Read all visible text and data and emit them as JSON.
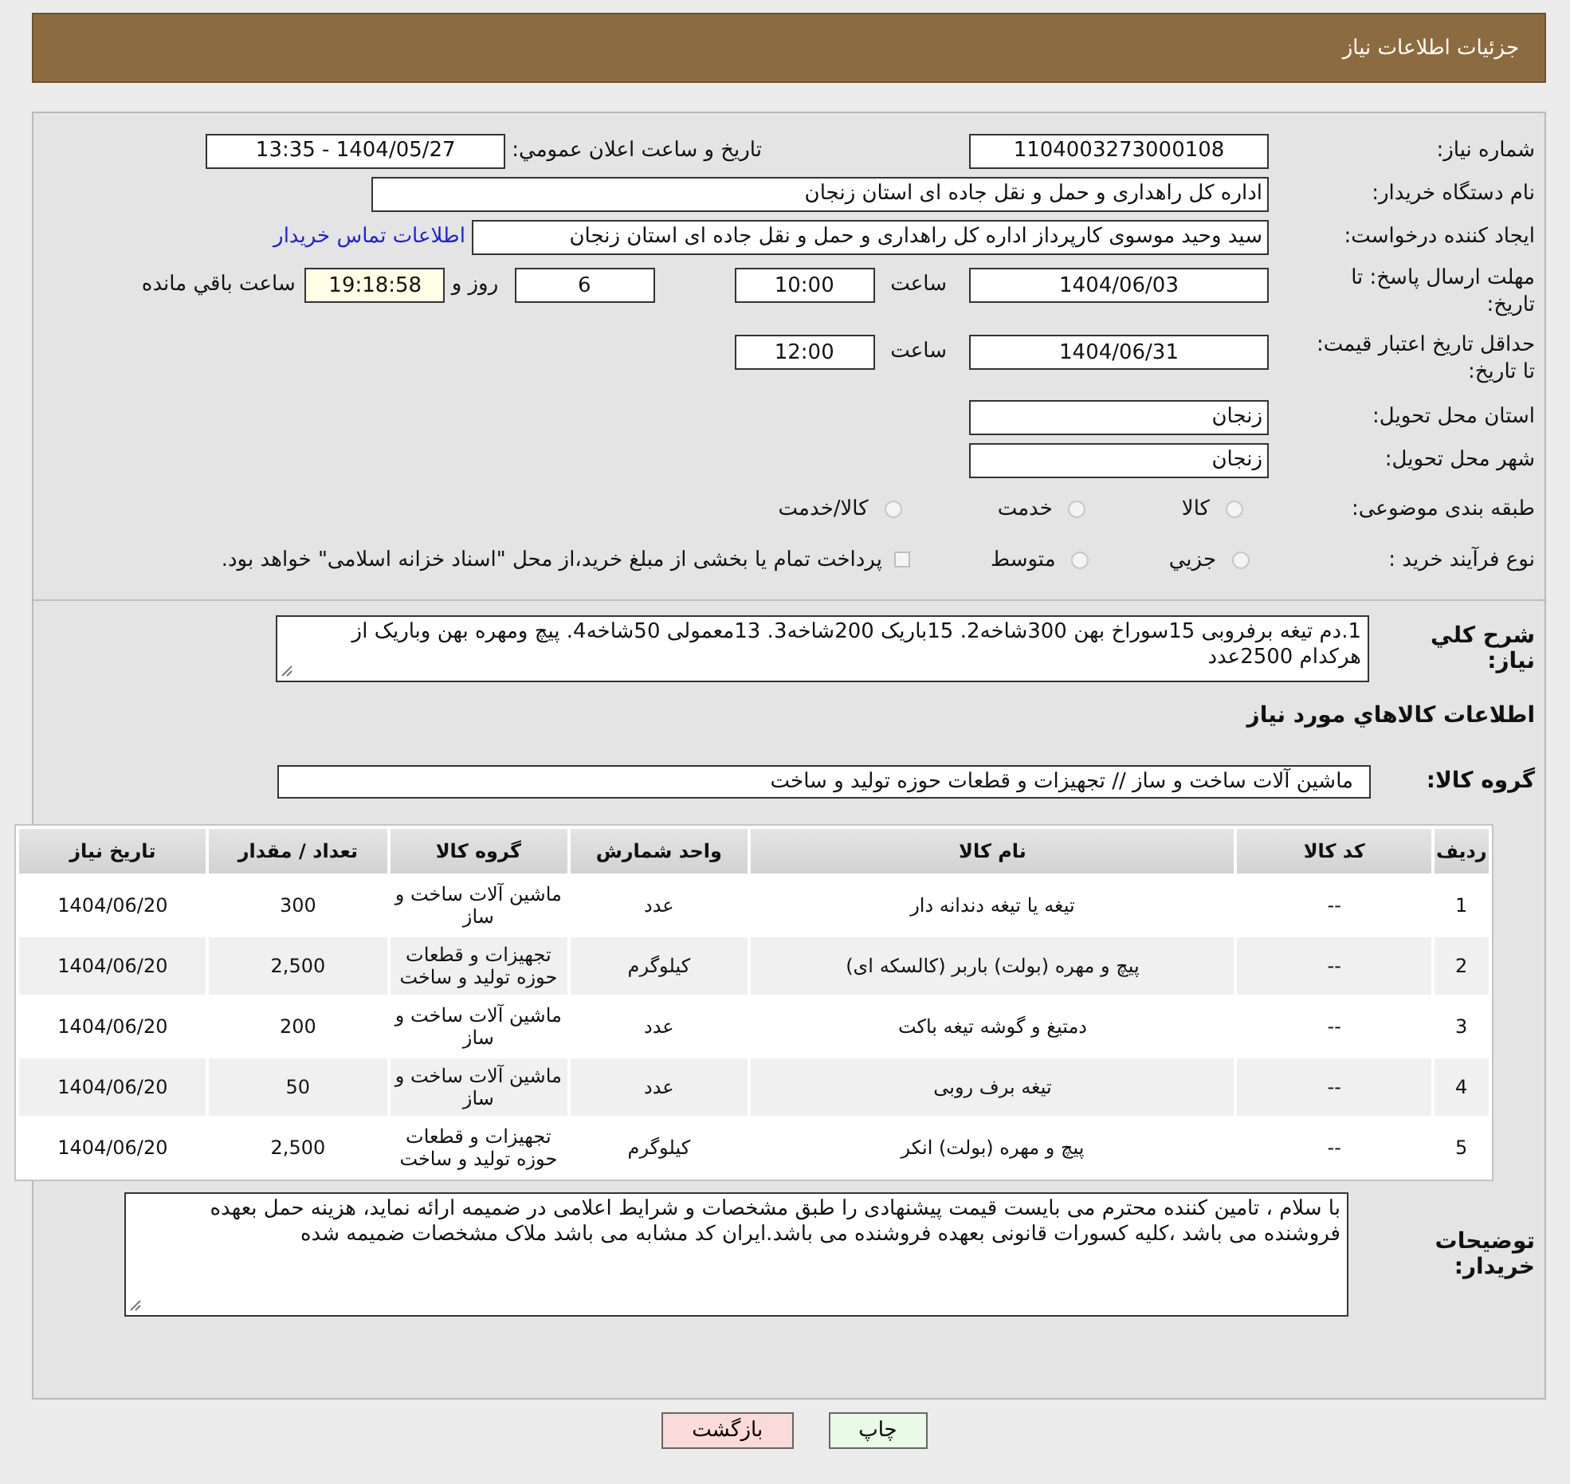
{
  "header": {
    "title": "جزئیات اطلاعات نیاز"
  },
  "need_number": {
    "label": "شماره نیاز:",
    "value": "1104003273000108"
  },
  "announce": {
    "label": "تاریخ و ساعت اعلان عمومي:",
    "value": "1404/05/27 - 13:35"
  },
  "buyer_org": {
    "label": "نام دستگاه خریدار:",
    "value": "اداره کل راهداری و حمل و نقل جاده ای استان زنجان"
  },
  "requester": {
    "label": "ایجاد کننده درخواست:",
    "value": "سید وحید موسوی کارپرداز اداره کل راهداری و حمل و نقل جاده ای استان زنجان",
    "link": "اطلاعات تماس خریدار"
  },
  "response_deadline": {
    "label": "مهلت ارسال پاسخ: تا تاریخ:",
    "date": "1404/06/03",
    "time_label": "ساعت",
    "time": "10:00",
    "days": "6",
    "days_label": "روز و",
    "remaining": "19:18:58",
    "remaining_label": "ساعت باقي مانده"
  },
  "price_validity": {
    "label": "حداقل تاریخ اعتبار قیمت: تا تاریخ:",
    "date": "1404/06/31",
    "time_label": "ساعت",
    "time": "12:00"
  },
  "province": {
    "label": "استان محل تحویل:",
    "value": "زنجان"
  },
  "city": {
    "label": "شهر محل تحویل:",
    "value": "زنجان"
  },
  "category": {
    "label": "طبقه بندی موضوعی:",
    "options": [
      {
        "kind": "radio",
        "label": "کالا",
        "selected": false
      },
      {
        "kind": "radio",
        "label": "خدمت",
        "selected": false
      },
      {
        "kind": "radio",
        "label": "کالا/خدمت",
        "selected": false
      }
    ]
  },
  "process": {
    "label": "نوع فرآیند خرید :",
    "options": [
      {
        "kind": "radio",
        "label": "جزيي",
        "selected": false
      },
      {
        "kind": "radio",
        "label": "متوسط",
        "selected": false
      },
      {
        "kind": "checkbox",
        "label": "پرداخت تمام یا بخشی از مبلغ خرید،از محل \"اسناد خزانه اسلامی\" خواهد بود.",
        "checked": false
      }
    ]
  },
  "description": {
    "label": "شرح کلي نیاز:",
    "value": "1.دم تیغه برفروبی 15سوراخ بهن 300شاخه2. 15باریک 200شاخه3. 13معمولی 50شاخه4. پیچ ومهره بهن وباریک از هرکدام 2500عدد"
  },
  "goods_heading": "اطلاعات کالاهاي مورد نیاز",
  "goods_group": {
    "label": "گروه کالا:",
    "value": "ماشین آلات ساخت و ساز // تجهیزات و قطعات حوزه تولید و ساخت"
  },
  "table": {
    "columns": [
      "ردیف",
      "کد کالا",
      "نام کالا",
      "واحد شمارش",
      "گروه کالا",
      "تعداد / مقدار",
      "تاریخ نیاز"
    ],
    "rows": [
      [
        "1",
        "--",
        "تیغه یا تیغه دندانه دار",
        "عدد",
        "ماشین آلات ساخت و ساز",
        "300",
        "1404/06/20"
      ],
      [
        "2",
        "--",
        "پیچ و مهره (بولت) باربر (کالسکه ای)",
        "کیلوگرم",
        "تجهیزات و قطعات حوزه تولید و ساخت",
        "2,500",
        "1404/06/20"
      ],
      [
        "3",
        "--",
        "دمتیغ و گوشه تیغه باکت",
        "عدد",
        "ماشین آلات ساخت و ساز",
        "200",
        "1404/06/20"
      ],
      [
        "4",
        "--",
        "تیغه برف روبی",
        "عدد",
        "ماشین آلات ساخت و ساز",
        "50",
        "1404/06/20"
      ],
      [
        "5",
        "--",
        "پیچ و مهره (بولت) انکر",
        "کیلوگرم",
        "تجهیزات و قطعات حوزه تولید و ساخت",
        "2,500",
        "1404/06/20"
      ]
    ]
  },
  "buyer_notes": {
    "label": "توضیحات خریدار:",
    "value": "با سلام ، تامین کننده محترم می بایست قیمت پیشنهادی را طبق مشخصات و شرایط اعلامی در ضمیمه ارائه نماید، هزینه حمل بعهده فروشنده می باشد ،کلیه کسورات قانونی بعهده فروشنده می باشد.ایران کد مشابه می باشد ملاک مشخصات ضمیمه شده"
  },
  "buttons": [
    {
      "kind": "print",
      "label": "چاپ"
    },
    {
      "kind": "back",
      "label": "بازگشت"
    }
  ]
}
